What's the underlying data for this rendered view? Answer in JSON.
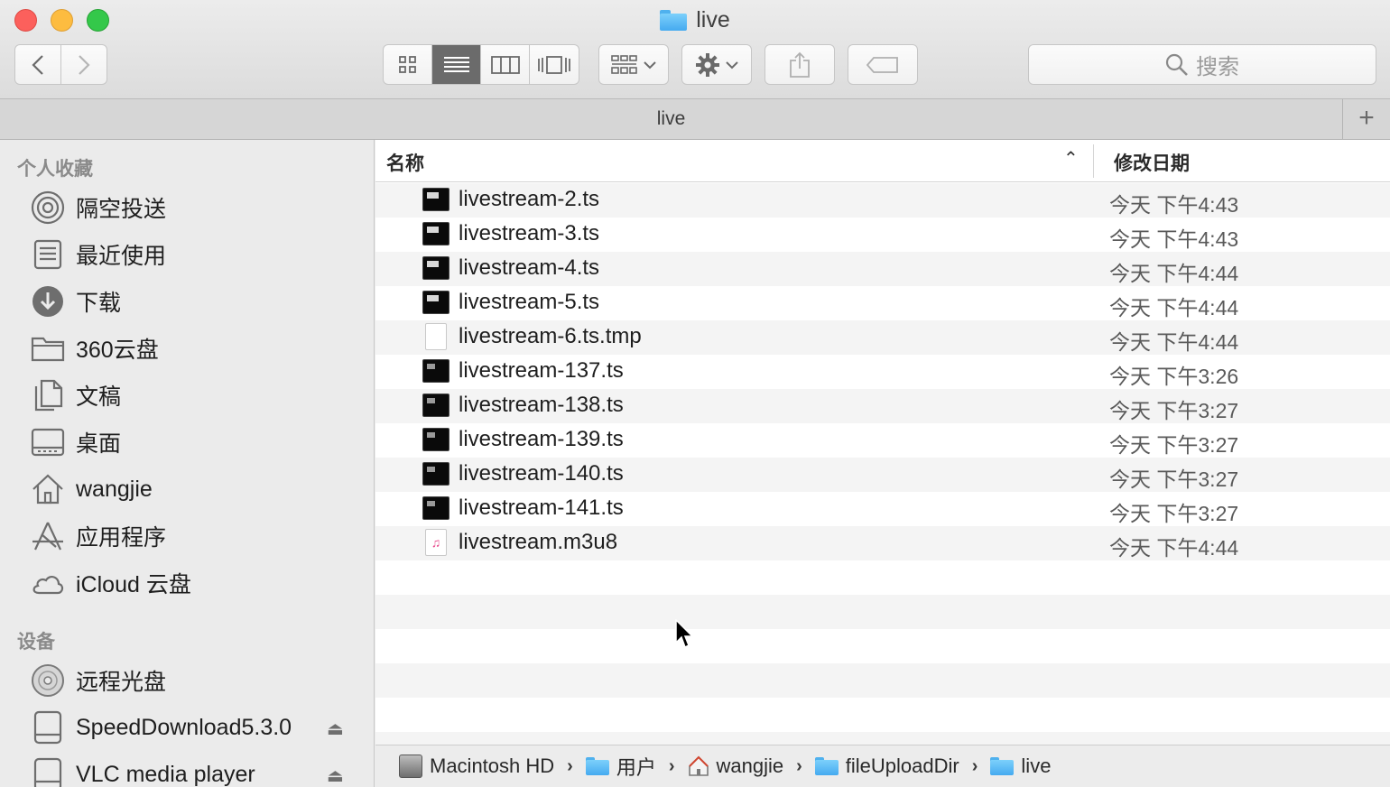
{
  "window": {
    "title": "live",
    "tab_title": "live",
    "tab_add": "+"
  },
  "toolbar": {
    "back_icon": "chevron-left-icon",
    "forward_icon": "chevron-right-icon",
    "views": [
      "icon-view",
      "list-view",
      "column-view",
      "cover-flow-view"
    ],
    "active_view": "list-view",
    "search_placeholder": "搜索"
  },
  "sidebar": {
    "favorites_heading": "个人收藏",
    "favorites": [
      {
        "label": "隔空投送",
        "icon": "airdrop-icon"
      },
      {
        "label": "最近使用",
        "icon": "recents-icon"
      },
      {
        "label": "下载",
        "icon": "downloads-icon"
      },
      {
        "label": "360云盘",
        "icon": "folder-icon"
      },
      {
        "label": "文稿",
        "icon": "documents-icon"
      },
      {
        "label": "桌面",
        "icon": "desktop-icon"
      },
      {
        "label": "wangjie",
        "icon": "home-icon"
      },
      {
        "label": "应用程序",
        "icon": "applications-icon"
      },
      {
        "label": "iCloud 云盘",
        "icon": "icloud-icon"
      }
    ],
    "devices_heading": "设备",
    "devices": [
      {
        "label": "远程光盘",
        "icon": "disc-icon"
      },
      {
        "label": "SpeedDownload5.3.0",
        "icon": "drive-icon"
      },
      {
        "label": "VLC media player",
        "icon": "drive-icon"
      }
    ]
  },
  "list": {
    "col_name": "名称",
    "col_date": "修改日期",
    "sort_indicator": "⌃",
    "files": [
      {
        "name": "livestream-2.ts",
        "date": "今天 下午4:43",
        "type": "ts"
      },
      {
        "name": "livestream-3.ts",
        "date": "今天 下午4:43",
        "type": "ts"
      },
      {
        "name": "livestream-4.ts",
        "date": "今天 下午4:44",
        "type": "ts"
      },
      {
        "name": "livestream-5.ts",
        "date": "今天 下午4:44",
        "type": "ts"
      },
      {
        "name": "livestream-6.ts.tmp",
        "date": "今天 下午4:44",
        "type": "doc"
      },
      {
        "name": "livestream-137.ts",
        "date": "今天 下午3:26",
        "type": "ts-small"
      },
      {
        "name": "livestream-138.ts",
        "date": "今天 下午3:27",
        "type": "ts-small"
      },
      {
        "name": "livestream-139.ts",
        "date": "今天 下午3:27",
        "type": "ts-small"
      },
      {
        "name": "livestream-140.ts",
        "date": "今天 下午3:27",
        "type": "ts-small"
      },
      {
        "name": "livestream-141.ts",
        "date": "今天 下午3:27",
        "type": "ts-small"
      },
      {
        "name": "livestream.m3u8",
        "date": "今天 下午4:44",
        "type": "m3u8"
      }
    ]
  },
  "pathbar": {
    "items": [
      "Macintosh HD",
      "用户",
      "wangjie",
      "fileUploadDir",
      "live"
    ],
    "separator": "›"
  }
}
